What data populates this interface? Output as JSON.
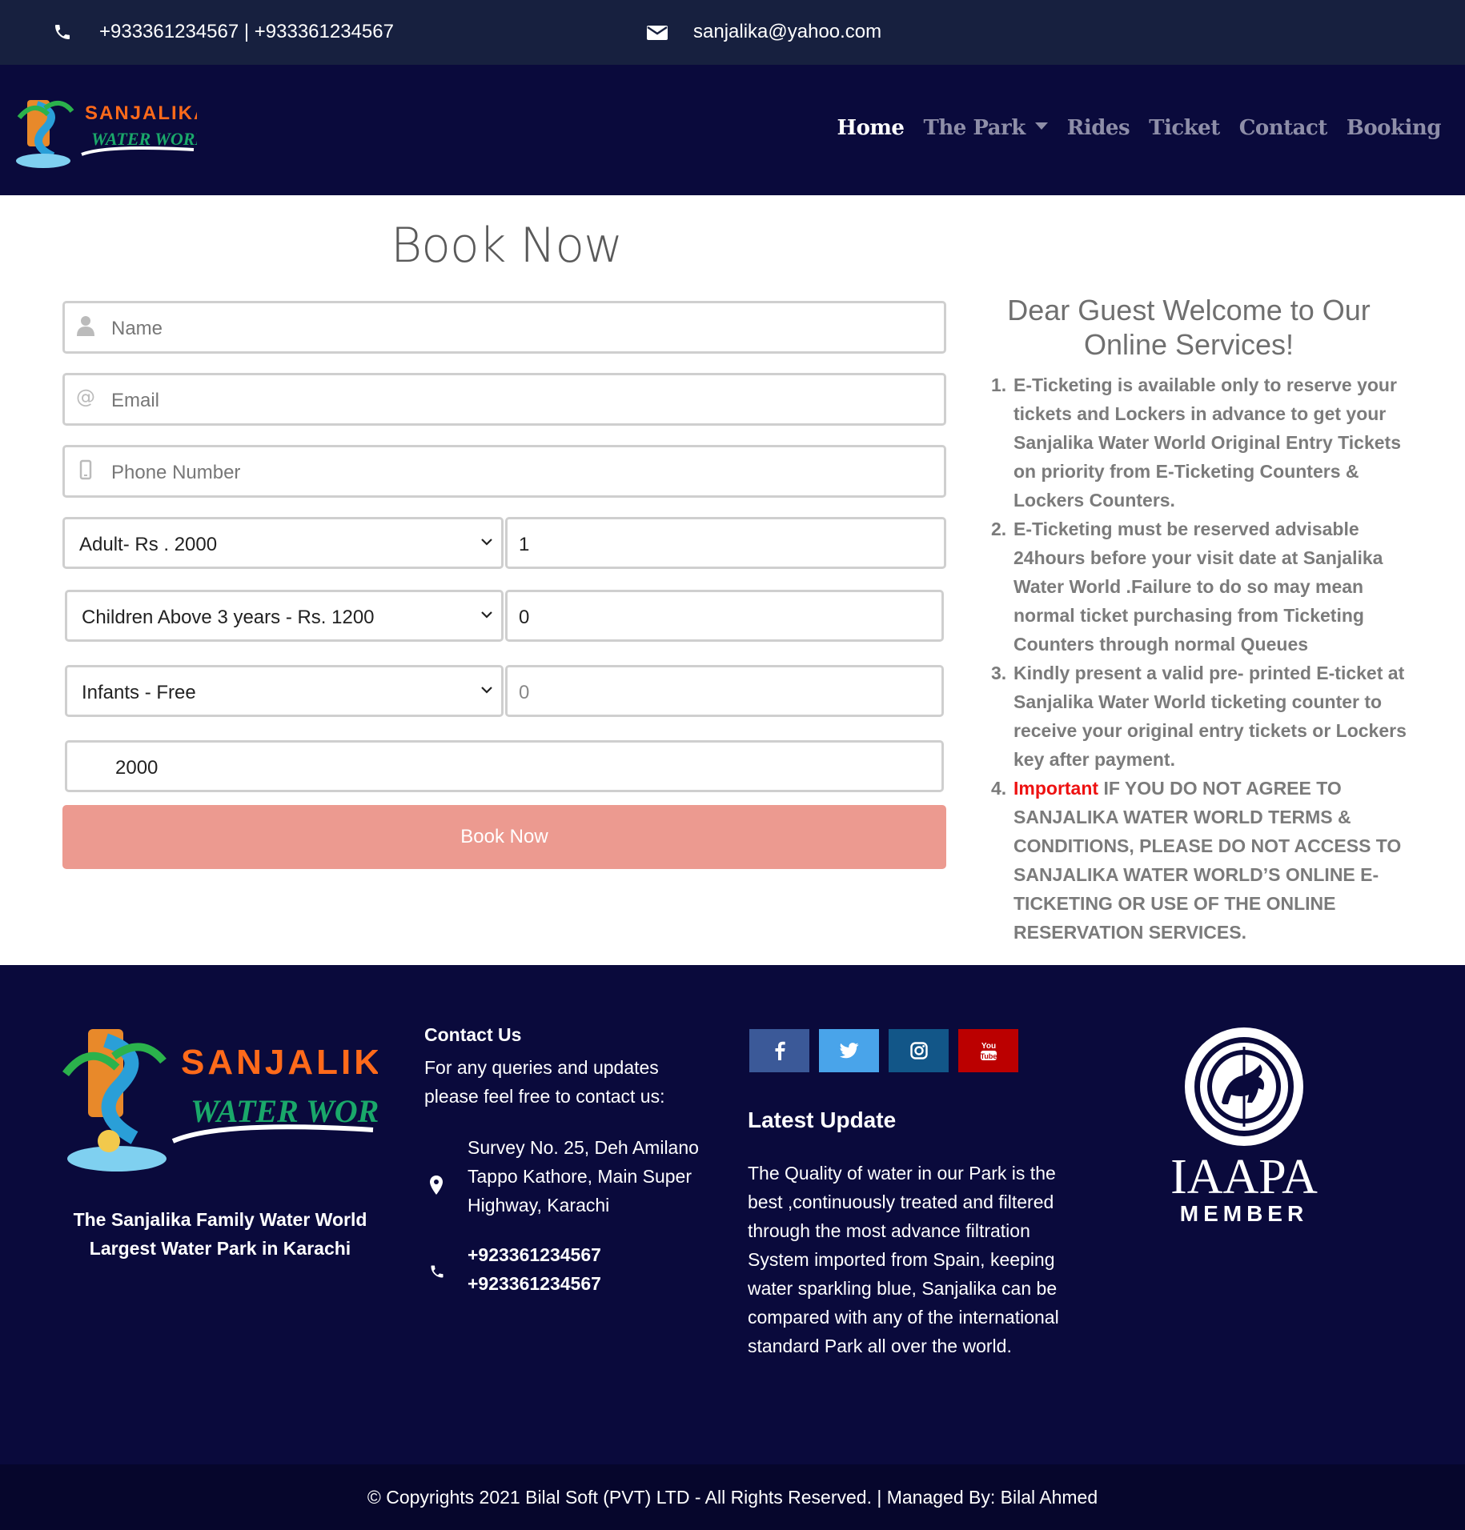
{
  "topbar": {
    "phone": "+933361234567 | +933361234567",
    "email": "sanjalika@yahoo.com"
  },
  "nav": {
    "items": [
      {
        "label": "Home",
        "active": true
      },
      {
        "label": "The Park",
        "active": false
      },
      {
        "label": "Rides",
        "active": false
      },
      {
        "label": "Ticket",
        "active": false
      },
      {
        "label": "Contact",
        "active": false
      },
      {
        "label": "Booking",
        "active": false
      }
    ]
  },
  "logo": {
    "line1": "SANJALIKA",
    "line2": "WATER WORLD"
  },
  "form": {
    "title": "Book Now",
    "name_placeholder": "Name",
    "email_placeholder": "Email",
    "phone_placeholder": "Phone Number",
    "adult_select": "Adult- Rs . 2000",
    "adult_qty": "1",
    "children_select": "Children Above 3 years - Rs. 1200",
    "children_qty": "0",
    "infant_select": "Infants - Free",
    "infant_qty": "0",
    "total": "2000",
    "submit": "Book Now"
  },
  "info": {
    "heading": "Dear Guest Welcome to Our Online Services!",
    "items": [
      "E-Ticketing is available only to reserve your tickets and Lockers in advance to get your Sanjalika Water World Original Entry Tickets on priority from E-Ticketing Counters & Lockers Counters.",
      "E-Ticketing must be reserved advisable 24hours before your visit date at Sanjalika Water World .Failure to do so may mean normal ticket purchasing from Ticketing Counters through normal Queues",
      "Kindly present a valid pre- printed E-ticket at Sanjalika Water World ticketing counter to receive your original entry tickets or Lockers key after payment."
    ],
    "important_label": "Important",
    "important_text": "IF YOU DO NOT AGREE TO SANJALIKA WATER WORLD TERMS & CONDITIONS, PLEASE DO NOT ACCESS TO SANJALIKA WATER WORLD’S ONLINE E-TICKETING OR USE OF THE ONLINE RESERVATION SERVICES."
  },
  "footer": {
    "tagline": "The Sanjalika Family Water World Largest Water Park in Karachi",
    "contact_title": "Contact Us",
    "contact_desc": "For any queries and updates please feel free to contact us:",
    "address": "Survey No. 25, Deh Amilano Tappo Kathore, Main Super Highway, Karachi",
    "phone1": "+923361234567",
    "phone2": "+923361234567",
    "latest_title": "Latest Update",
    "latest_body": "The Quality of water in our Park is the best ,continuously treated and filtered through the most advance filtration System imported from Spain, keeping water sparkling blue, Sanjalika can be compared with any of the international standard Park all over the world.",
    "iaapa_name": "IAAPA",
    "iaapa_sub": "MEMBER",
    "social": [
      "facebook",
      "twitter",
      "instagram",
      "youtube"
    ],
    "youtube_label": "You Tube"
  },
  "copyright": "© Copyrights 2021 Bilal Soft (PVT) LTD - All Rights Reserved. | Managed By: Bilal Ahmed",
  "colors": {
    "topbar": "#17203f",
    "nav": "#0a0a3c",
    "button": "#ec9a90",
    "important": "#ee1111"
  }
}
